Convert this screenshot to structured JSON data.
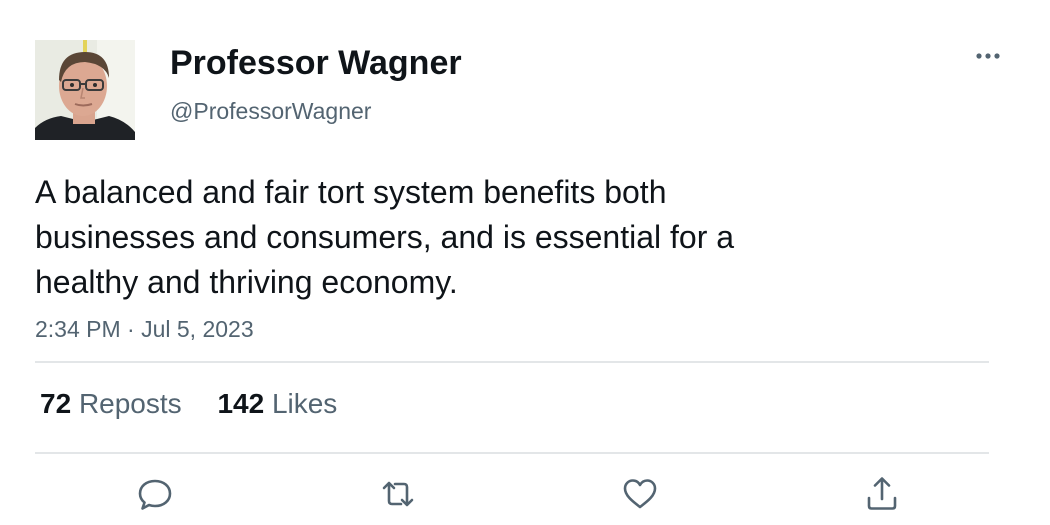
{
  "author": {
    "display_name": "Professor Wagner",
    "handle": "@ProfessorWagner",
    "avatar": "profile-photo-man-with-glasses"
  },
  "menu_icon": "more-horizontal-icon",
  "tweet": {
    "text": "A balanced and fair tort system benefits both businesses and consumers, and is essential for a healthy and thriving economy.",
    "timestamp": "2:34 PM · Jul 5, 2023"
  },
  "stats": {
    "reposts_count": "72",
    "reposts_label": "Reposts",
    "likes_count": "142",
    "likes_label": "Likes"
  },
  "actions": [
    {
      "icon": "reply-icon"
    },
    {
      "icon": "repost-icon"
    },
    {
      "icon": "like-icon"
    },
    {
      "icon": "share-icon"
    }
  ],
  "colors": {
    "text_primary": "#0f1419",
    "text_secondary": "#536471",
    "divider": "#e3e6e8"
  }
}
